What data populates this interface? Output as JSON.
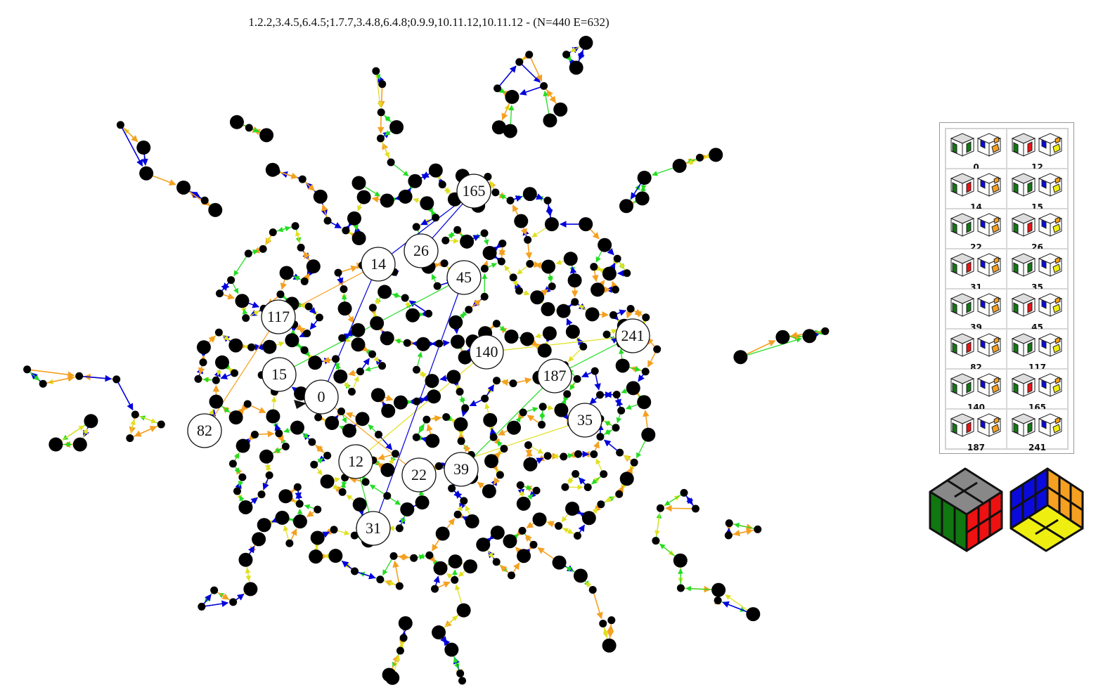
{
  "title": "1.2.2,3.4.5,6.4.5;1.7.7,3.4.8,6.4.8;0.9.9,10.11.12,10.11.12 - (N=440 E=632)",
  "edge_colors": {
    "a": "#0000dd",
    "b": "#22dd22",
    "c": "#f5a020",
    "d": "#e0e020"
  },
  "labeled_nodes": [
    "0",
    "12",
    "14",
    "15",
    "22",
    "26",
    "31",
    "35",
    "39",
    "45",
    "82",
    "117",
    "140",
    "165",
    "187",
    "241"
  ],
  "legend": {
    "entries": [
      {
        "label": "0"
      },
      {
        "label": "12"
      },
      {
        "label": "14"
      },
      {
        "label": "15"
      },
      {
        "label": "22"
      },
      {
        "label": "26"
      },
      {
        "label": "31"
      },
      {
        "label": "35"
      },
      {
        "label": "39"
      },
      {
        "label": "45"
      },
      {
        "label": "82"
      },
      {
        "label": "117"
      },
      {
        "label": "140"
      },
      {
        "label": "165"
      },
      {
        "label": "187"
      },
      {
        "label": "241"
      }
    ]
  },
  "cube_colors": {
    "top": "#888888",
    "front": "#117711",
    "right": "#ee1111",
    "blue": "#0a0add",
    "orange": "#f5a020",
    "yellow": "#eeee11"
  }
}
